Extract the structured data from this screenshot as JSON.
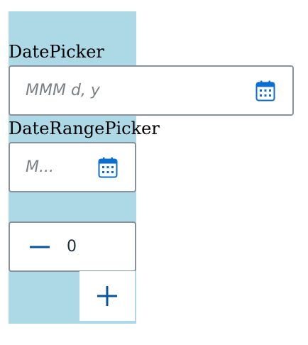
{
  "colors": {
    "panel_background": "#add8e6",
    "field_border": "#89919a",
    "placeholder_text": "#7b8085",
    "icon_accent": "#0a6ed1"
  },
  "datepicker": {
    "label": "DatePicker",
    "placeholder": "MMM d, y",
    "icon": "calendar-icon"
  },
  "daterangepicker": {
    "label": "DateRangePicker",
    "placeholder": "M...",
    "icon": "calendar-icon"
  },
  "stepper": {
    "value": "0",
    "decrement_icon": "minus-icon",
    "increment_icon": "plus-icon"
  }
}
